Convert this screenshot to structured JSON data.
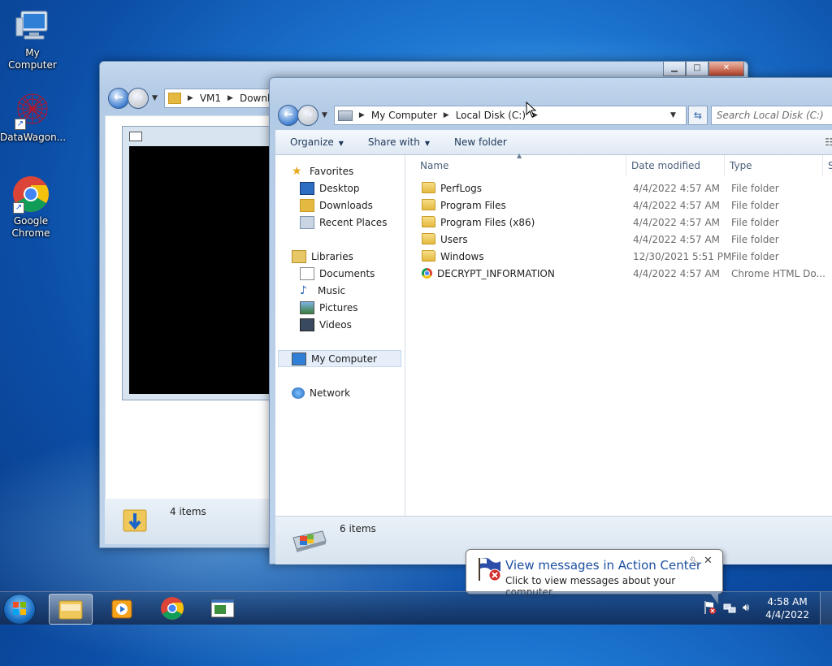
{
  "desktop": {
    "icons": [
      {
        "label": "My Computer"
      },
      {
        "label": "DataWagon..."
      },
      {
        "label": "Google Chrome"
      }
    ]
  },
  "back_window": {
    "address_parts": [
      "VM1",
      "Downlo"
    ],
    "status_count": "4 items"
  },
  "explorer": {
    "address_parts": [
      "My Computer",
      "Local Disk (C:)"
    ],
    "search_placeholder": "Search Local Disk (C:)",
    "toolbar": {
      "organize": "Organize",
      "share_with": "Share with",
      "new_folder": "New folder"
    },
    "nav": {
      "favorites": "Favorites",
      "desktop": "Desktop",
      "downloads": "Downloads",
      "recent_places": "Recent Places",
      "libraries": "Libraries",
      "documents": "Documents",
      "music": "Music",
      "pictures": "Pictures",
      "videos": "Videos",
      "my_computer": "My Computer",
      "network": "Network"
    },
    "columns": {
      "name": "Name",
      "date_modified": "Date modified",
      "type": "Type",
      "size": "S"
    },
    "files": [
      {
        "name": "PerfLogs",
        "date": "4/4/2022 4:57 AM",
        "type": "File folder",
        "icon": "folder-icon"
      },
      {
        "name": "Program Files",
        "date": "4/4/2022 4:57 AM",
        "type": "File folder",
        "icon": "folder-icon"
      },
      {
        "name": "Program Files (x86)",
        "date": "4/4/2022 4:57 AM",
        "type": "File folder",
        "icon": "folder-icon"
      },
      {
        "name": "Users",
        "date": "4/4/2022 4:57 AM",
        "type": "File folder",
        "icon": "folder-icon"
      },
      {
        "name": "Windows",
        "date": "12/30/2021 5:51 PM",
        "type": "File folder",
        "icon": "folder-icon"
      },
      {
        "name": "DECRYPT_INFORMATION",
        "date": "4/4/2022 4:57 AM",
        "type": "Chrome HTML Do...",
        "icon": "chrome-html-icon"
      }
    ],
    "status_count": "6 items"
  },
  "balloon": {
    "title": "View messages in Action Center",
    "body": "Click to view messages about your computer."
  },
  "taskbar": {
    "time": "4:58 AM",
    "date": "4/4/2022"
  },
  "colors": {
    "desktop_blue": "#1c74cf",
    "link_blue": "#1c4fa0"
  }
}
